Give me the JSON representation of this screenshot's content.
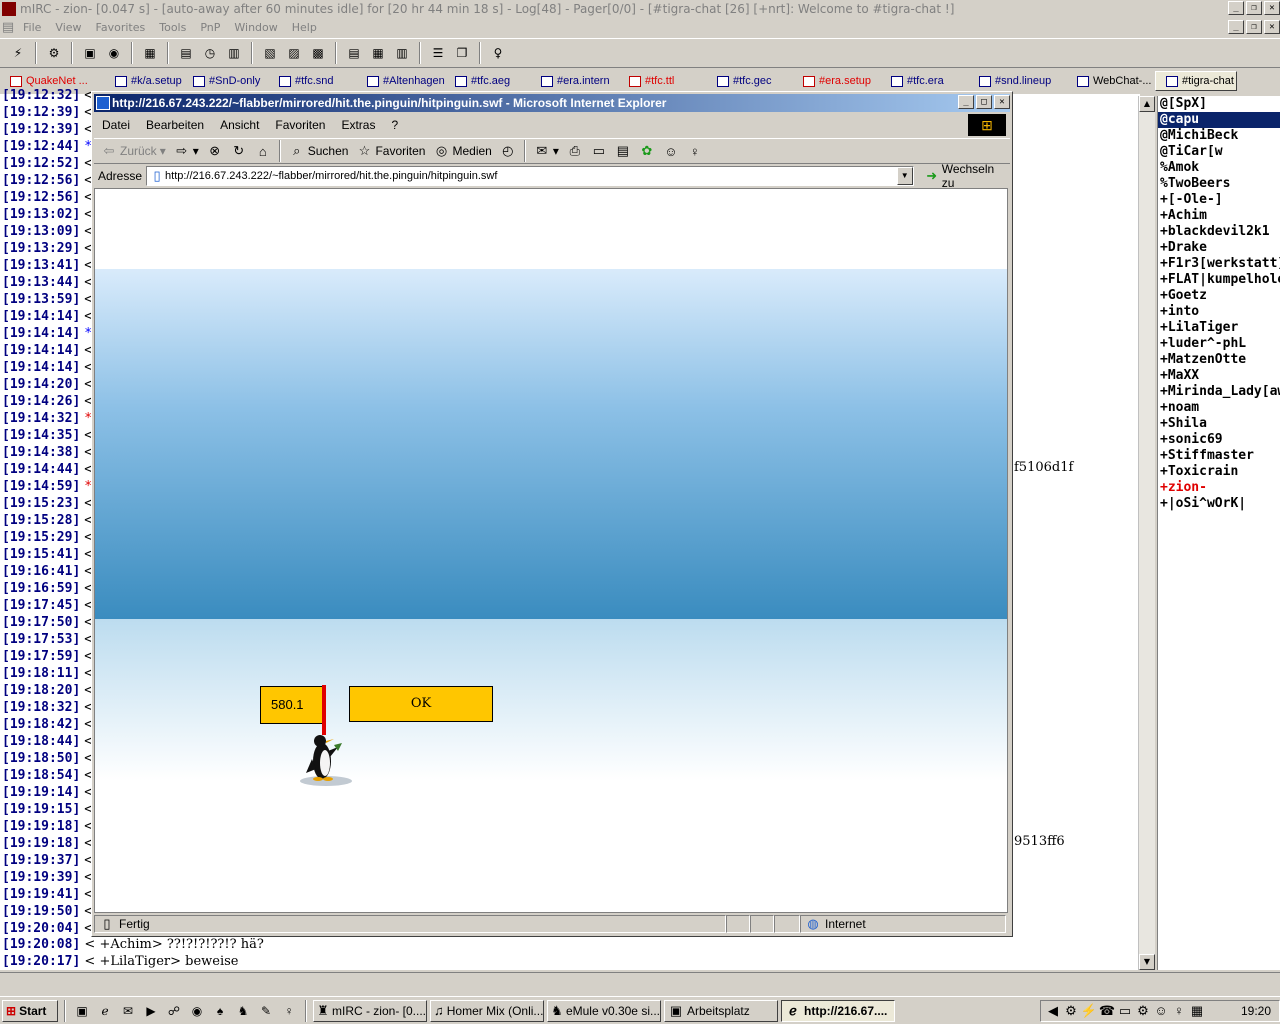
{
  "mirc": {
    "title": "mIRC - zion- [0.047 s] - [auto-away after 60 minutes idle] for [20 hr 44 min 18 s] - Log[48] - Pager[0/0] - [#tigra-chat [26] [+nrt]: Welcome to #tigra-chat !]",
    "menu": [
      "File",
      "View",
      "Favorites",
      "Tools",
      "PnP",
      "Window",
      "Help"
    ],
    "tabs": [
      {
        "label": "QuakeNet ...",
        "color": "red"
      },
      {
        "label": "#k/a.setup",
        "color": "blue"
      },
      {
        "label": "#SnD-only",
        "color": "blue"
      },
      {
        "label": "#tfc.snd",
        "color": "blue"
      },
      {
        "label": "#Altenhagen",
        "color": "blue"
      },
      {
        "label": "#tfc.aeg",
        "color": "blue"
      },
      {
        "label": "#era.intern",
        "color": "blue"
      },
      {
        "label": "#tfc.ttl",
        "color": "red"
      },
      {
        "label": "#tfc.gec",
        "color": "blue"
      },
      {
        "label": "#era.setup",
        "color": "red"
      },
      {
        "label": "#tfc.era",
        "color": "blue"
      },
      {
        "label": "#snd.lineup",
        "color": "blue"
      },
      {
        "label": "WebChat-...",
        "color": "black"
      },
      {
        "label": "#tigra-chat",
        "color": "black"
      }
    ],
    "chat_lines": [
      {
        "ts": "[19:12:32]",
        "mark": "<",
        "mark_color": "black"
      },
      {
        "ts": "[19:12:39]",
        "mark": "<",
        "mark_color": "black"
      },
      {
        "ts": "[19:12:39]",
        "mark": "<",
        "mark_color": "black"
      },
      {
        "ts": "[19:12:44]",
        "mark": "*°",
        "mark_color": "blue"
      },
      {
        "ts": "[19:12:52]",
        "mark": "<",
        "mark_color": "black"
      },
      {
        "ts": "[19:12:56]",
        "mark": "<",
        "mark_color": "black"
      },
      {
        "ts": "[19:12:56]",
        "mark": "<",
        "mark_color": "black"
      },
      {
        "ts": "[19:13:02]",
        "mark": "<",
        "mark_color": "black"
      },
      {
        "ts": "[19:13:09]",
        "mark": "<",
        "mark_color": "black"
      },
      {
        "ts": "[19:13:29]",
        "mark": "<",
        "mark_color": "black"
      },
      {
        "ts": "[19:13:41]",
        "mark": "<",
        "mark_color": "black"
      },
      {
        "ts": "[19:13:44]",
        "mark": "<",
        "mark_color": "black"
      },
      {
        "ts": "[19:13:59]",
        "mark": "<",
        "mark_color": "black"
      },
      {
        "ts": "[19:14:14]",
        "mark": "<",
        "mark_color": "black"
      },
      {
        "ts": "[19:14:14]",
        "mark": "*°",
        "mark_color": "blue"
      },
      {
        "ts": "[19:14:14]",
        "mark": "<",
        "mark_color": "black"
      },
      {
        "ts": "[19:14:14]",
        "mark": "<",
        "mark_color": "black"
      },
      {
        "ts": "[19:14:20]",
        "mark": "<",
        "mark_color": "black"
      },
      {
        "ts": "[19:14:26]",
        "mark": "<",
        "mark_color": "black"
      },
      {
        "ts": "[19:14:32]",
        "mark": "*°",
        "mark_color": "red"
      },
      {
        "ts": "[19:14:35]",
        "mark": "<",
        "mark_color": "black"
      },
      {
        "ts": "[19:14:38]",
        "mark": "<",
        "mark_color": "black"
      },
      {
        "ts": "[19:14:44]",
        "mark": "<",
        "mark_color": "black"
      },
      {
        "ts": "[19:14:59]",
        "mark": "*°",
        "mark_color": "red"
      },
      {
        "ts": "[19:15:23]",
        "mark": "<",
        "mark_color": "black"
      },
      {
        "ts": "[19:15:28]",
        "mark": "<",
        "mark_color": "black"
      },
      {
        "ts": "[19:15:29]",
        "mark": "<",
        "mark_color": "black"
      },
      {
        "ts": "[19:15:41]",
        "mark": "<",
        "mark_color": "black"
      },
      {
        "ts": "[19:16:41]",
        "mark": "<",
        "mark_color": "black"
      },
      {
        "ts": "[19:16:59]",
        "mark": "<",
        "mark_color": "black"
      },
      {
        "ts": "[19:17:45]",
        "mark": "<",
        "mark_color": "black"
      },
      {
        "ts": "[19:17:50]",
        "mark": "<",
        "mark_color": "black"
      },
      {
        "ts": "[19:17:53]",
        "mark": "<",
        "mark_color": "black"
      },
      {
        "ts": "[19:17:59]",
        "mark": "<",
        "mark_color": "black"
      },
      {
        "ts": "[19:18:11]",
        "mark": "<",
        "mark_color": "black"
      },
      {
        "ts": "[19:18:20]",
        "mark": "<",
        "mark_color": "black"
      },
      {
        "ts": "[19:18:32]",
        "mark": "<",
        "mark_color": "black"
      },
      {
        "ts": "[19:18:42]",
        "mark": "<",
        "mark_color": "black"
      },
      {
        "ts": "[19:18:44]",
        "mark": "<",
        "mark_color": "black"
      },
      {
        "ts": "[19:18:50]",
        "mark": "<",
        "mark_color": "black"
      },
      {
        "ts": "[19:18:54]",
        "mark": "<",
        "mark_color": "black"
      },
      {
        "ts": "[19:19:14]",
        "mark": "<",
        "mark_color": "black"
      },
      {
        "ts": "[19:19:15]",
        "mark": "<",
        "mark_color": "black"
      },
      {
        "ts": "[19:19:18]",
        "mark": "<",
        "mark_color": "black"
      },
      {
        "ts": "[19:19:18]",
        "mark": "<",
        "mark_color": "black"
      },
      {
        "ts": "[19:19:37]",
        "mark": "<",
        "mark_color": "black"
      },
      {
        "ts": "[19:19:39]",
        "mark": "<",
        "mark_color": "black"
      },
      {
        "ts": "[19:19:41]",
        "mark": "<",
        "mark_color": "black"
      },
      {
        "ts": "[19:19:50]",
        "mark": "<",
        "mark_color": "black"
      },
      {
        "ts": "[19:20:04]",
        "mark": "<",
        "mark_color": "black"
      }
    ],
    "last_lines": [
      {
        "ts": "[19:20:08]",
        "text": "< +Achim> ??!?!?!??!? hä?"
      },
      {
        "ts": "[19:20:17]",
        "text": "< +LilaTiger> beweise"
      }
    ],
    "fragment_1": "f5106d1f",
    "fragment_2": "9513ff6",
    "nicklist": [
      {
        "nick": "@[SpX]",
        "state": "normal"
      },
      {
        "nick": "@capu",
        "state": "selected"
      },
      {
        "nick": "@MichiBeck",
        "state": "normal"
      },
      {
        "nick": "@TiCar[w",
        "state": "normal"
      },
      {
        "nick": "%Amok",
        "state": "normal"
      },
      {
        "nick": "%TwoBeers",
        "state": "normal"
      },
      {
        "nick": "+[-Ole-]",
        "state": "normal"
      },
      {
        "nick": "+Achim",
        "state": "normal"
      },
      {
        "nick": "+blackdevil2k1",
        "state": "normal"
      },
      {
        "nick": "+Drake",
        "state": "normal"
      },
      {
        "nick": "+F1r3[werkstatt]",
        "state": "normal"
      },
      {
        "nick": "+FLAT|kumpelhole",
        "state": "normal"
      },
      {
        "nick": "+Goetz",
        "state": "normal"
      },
      {
        "nick": "+into",
        "state": "normal"
      },
      {
        "nick": "+LilaTiger",
        "state": "normal"
      },
      {
        "nick": "+luder^-phL",
        "state": "normal"
      },
      {
        "nick": "+MatzenOtte",
        "state": "normal"
      },
      {
        "nick": "+MaXX",
        "state": "normal"
      },
      {
        "nick": "+Mirinda_Lady[aw",
        "state": "normal"
      },
      {
        "nick": "+noam",
        "state": "normal"
      },
      {
        "nick": "+Shila",
        "state": "normal"
      },
      {
        "nick": "+sonic69",
        "state": "normal"
      },
      {
        "nick": "+Stiffmaster",
        "state": "normal"
      },
      {
        "nick": "+Toxicrain",
        "state": "normal"
      },
      {
        "nick": "+zion-",
        "state": "self"
      },
      {
        "nick": "+|oSi^wOrK|",
        "state": "normal"
      }
    ]
  },
  "ie": {
    "title": "http://216.67.243.222/~flabber/mirrored/hit.the.pinguin/hitpinguin.swf - Microsoft Internet Explorer",
    "menu": [
      "Datei",
      "Bearbeiten",
      "Ansicht",
      "Favoriten",
      "Extras",
      "?"
    ],
    "toolbar": {
      "back": "Zurück",
      "search": "Suchen",
      "favorites": "Favoriten",
      "media": "Medien"
    },
    "address_label": "Adresse",
    "address_value": "http://216.67.243.222/~flabber/mirrored/hit.the.pinguin/hitpinguin.swf",
    "go_label": "Wechseln zu",
    "game": {
      "distance": "580.1",
      "ok_label": "OK"
    },
    "status_text": "Fertig",
    "zone_text": "Internet"
  },
  "taskbar": {
    "start_label": "Start",
    "tasks": [
      {
        "label": "mIRC - zion- [0....",
        "active": false
      },
      {
        "label": "Homer Mix (Onli...",
        "active": false
      },
      {
        "label": "eMule v0.30e si...",
        "active": false
      },
      {
        "label": "Arbeitsplatz",
        "active": false
      },
      {
        "label": "http://216.67....",
        "active": true
      }
    ],
    "clock": "19:20"
  },
  "colors": {
    "title_active": "#0a246a",
    "timestamp": "#000080",
    "game_yellow": "#ffc600",
    "highlight_red": "#e00000"
  }
}
